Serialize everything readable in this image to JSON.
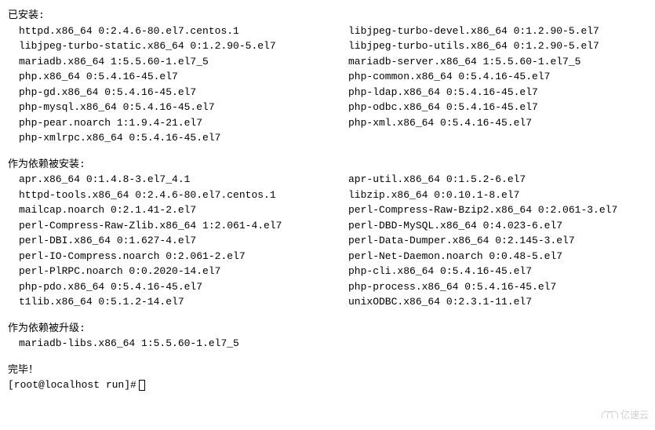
{
  "sections": {
    "installed": {
      "header": "已安装:",
      "rows": [
        {
          "left": "httpd.x86_64 0:2.4.6-80.el7.centos.1",
          "right": "libjpeg-turbo-devel.x86_64 0:1.2.90-5.el7"
        },
        {
          "left": "libjpeg-turbo-static.x86_64 0:1.2.90-5.el7",
          "right": "libjpeg-turbo-utils.x86_64 0:1.2.90-5.el7"
        },
        {
          "left": "mariadb.x86_64 1:5.5.60-1.el7_5",
          "right": "mariadb-server.x86_64 1:5.5.60-1.el7_5"
        },
        {
          "left": "php.x86_64 0:5.4.16-45.el7",
          "right": "php-common.x86_64 0:5.4.16-45.el7"
        },
        {
          "left": "php-gd.x86_64 0:5.4.16-45.el7",
          "right": "php-ldap.x86_64 0:5.4.16-45.el7"
        },
        {
          "left": "php-mysql.x86_64 0:5.4.16-45.el7",
          "right": "php-odbc.x86_64 0:5.4.16-45.el7"
        },
        {
          "left": "php-pear.noarch 1:1.9.4-21.el7",
          "right": "php-xml.x86_64 0:5.4.16-45.el7"
        },
        {
          "left": "php-xmlrpc.x86_64 0:5.4.16-45.el7",
          "right": ""
        }
      ]
    },
    "deps_installed": {
      "header": "作为依赖被安装:",
      "rows": [
        {
          "left": "apr.x86_64 0:1.4.8-3.el7_4.1",
          "right": "apr-util.x86_64 0:1.5.2-6.el7"
        },
        {
          "left": "httpd-tools.x86_64 0:2.4.6-80.el7.centos.1",
          "right": "libzip.x86_64 0:0.10.1-8.el7"
        },
        {
          "left": "mailcap.noarch 0:2.1.41-2.el7",
          "right": "perl-Compress-Raw-Bzip2.x86_64 0:2.061-3.el7"
        },
        {
          "left": "perl-Compress-Raw-Zlib.x86_64 1:2.061-4.el7",
          "right": "perl-DBD-MySQL.x86_64 0:4.023-6.el7"
        },
        {
          "left": "perl-DBI.x86_64 0:1.627-4.el7",
          "right": "perl-Data-Dumper.x86_64 0:2.145-3.el7"
        },
        {
          "left": "perl-IO-Compress.noarch 0:2.061-2.el7",
          "right": "perl-Net-Daemon.noarch 0:0.48-5.el7"
        },
        {
          "left": "perl-PlRPC.noarch 0:0.2020-14.el7",
          "right": "php-cli.x86_64 0:5.4.16-45.el7"
        },
        {
          "left": "php-pdo.x86_64 0:5.4.16-45.el7",
          "right": "php-process.x86_64 0:5.4.16-45.el7"
        },
        {
          "left": "t1lib.x86_64 0:5.1.2-14.el7",
          "right": "unixODBC.x86_64 0:2.3.1-11.el7"
        }
      ]
    },
    "deps_upgraded": {
      "header": "作为依赖被升级:",
      "rows": [
        {
          "left": "mariadb-libs.x86_64 1:5.5.60-1.el7_5",
          "right": ""
        }
      ]
    }
  },
  "complete": "完毕！",
  "prompt": "[root@localhost run]# ",
  "watermark": "亿速云"
}
